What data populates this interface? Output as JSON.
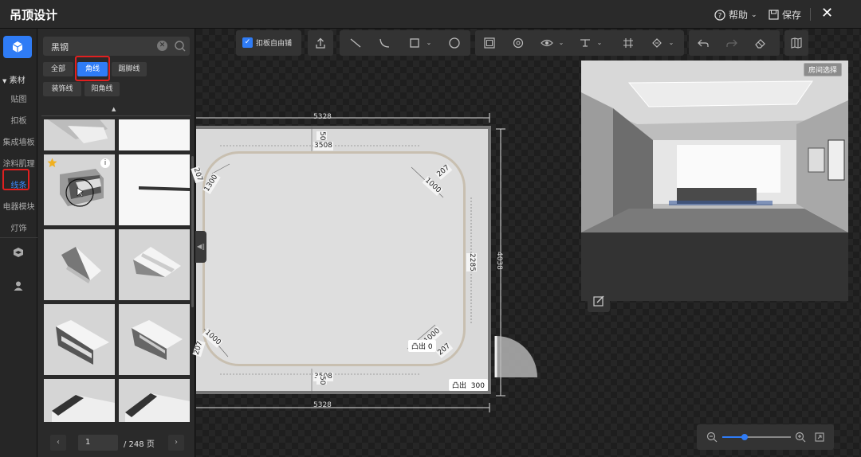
{
  "header": {
    "title": "吊顶设计",
    "help_label": "帮助",
    "save_label": "保存"
  },
  "leftnav": {
    "section_label": "素材",
    "items": [
      {
        "label": "贴图"
      },
      {
        "label": "扣板"
      },
      {
        "label": "集成墙板"
      },
      {
        "label": "涂料肌理"
      },
      {
        "label": "线条"
      },
      {
        "label": "电器模块"
      },
      {
        "label": "灯饰"
      }
    ],
    "active_item": "线条"
  },
  "panel": {
    "search_value": "黑钢",
    "tabs": [
      {
        "label": "全部"
      },
      {
        "label": "角线"
      },
      {
        "label": "踢脚线"
      },
      {
        "label": "装饰线"
      },
      {
        "label": "阳角线"
      }
    ],
    "active_tab": "角线",
    "pager": {
      "current_page": "1",
      "total_label": "/ 248 页"
    }
  },
  "toolbar": {
    "snap_label": "扣板自由铺"
  },
  "plan": {
    "dims": {
      "outer_width_top": "5328",
      "outer_width_bottom": "5328",
      "outer_height_right": "4038",
      "inner_width_top": "3508",
      "inner_width_bottom": "3508",
      "inner_height_right": "2285",
      "offset_top": "50",
      "offset_bottom": "50",
      "arc_tr": "1000",
      "arc_tl": "1300",
      "arc_br": "1000",
      "arc_bl": "1000",
      "corner_tl": "207",
      "corner_tr": "207",
      "corner_br": "207",
      "corner_bl": "207"
    },
    "bump_inner": {
      "label": "凸出",
      "value": "0"
    },
    "bump_outer": {
      "label": "凸出",
      "value": "300"
    }
  },
  "preview": {
    "room_select_label": "房间选择"
  },
  "colors": {
    "accent": "#2f7cf6",
    "highlight": "#e02020"
  }
}
